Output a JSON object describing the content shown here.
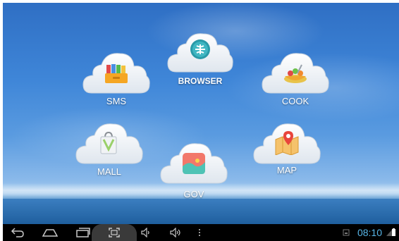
{
  "apps": {
    "browser": {
      "label": "BROWSER"
    },
    "sms": {
      "label": "SMS"
    },
    "cook": {
      "label": "COOK"
    },
    "mall": {
      "label": "MALL"
    },
    "gov": {
      "label": "GOV"
    },
    "map": {
      "label": "MAP"
    }
  },
  "status": {
    "time": "08:10"
  },
  "icons": {
    "nav": [
      "back-icon",
      "home-icon",
      "recent-apps-icon",
      "screenshot-icon",
      "volume-down-icon",
      "volume-up-icon",
      "menu-dots-icon"
    ],
    "tray": [
      "sd-card-icon",
      "signal-icon",
      "battery-icon"
    ]
  }
}
